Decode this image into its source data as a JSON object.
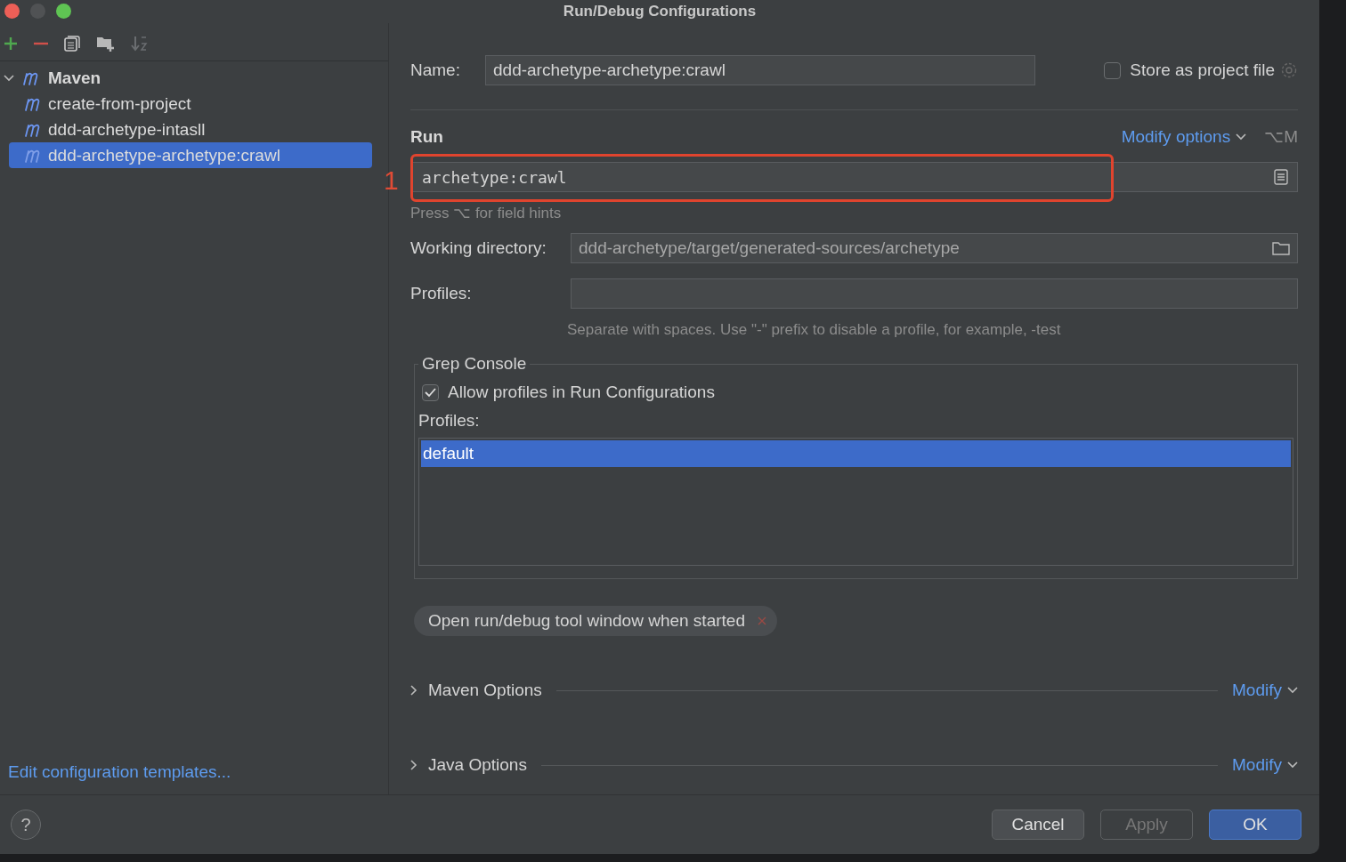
{
  "window": {
    "title": "Run/Debug Configurations"
  },
  "tree": {
    "label": "Maven",
    "expanded": true,
    "children": [
      {
        "label": "create-from-project",
        "selected": false
      },
      {
        "label": "ddd-archetype-intasll",
        "selected": false
      },
      {
        "label": "ddd-archetype-archetype:crawl",
        "selected": true
      }
    ]
  },
  "edit_templates_link": "Edit configuration templates...",
  "help": "?",
  "name_field": {
    "label": "Name:",
    "value": "ddd-archetype-archetype:crawl"
  },
  "store_as_project_file": {
    "label": "Store as project file",
    "checked": false
  },
  "run_section": {
    "title": "Run",
    "modify_options": "Modify options",
    "shortcut": "⌥M",
    "command": "archetype:crawl",
    "hint": "Press ⌥ for field hints",
    "annotation": "1"
  },
  "working_directory": {
    "label": "Working directory:",
    "value": "ddd-archetype/target/generated-sources/archetype"
  },
  "profiles": {
    "label": "Profiles:",
    "hint": "Separate with spaces. Use \"-\" prefix to disable a profile, for example, -test"
  },
  "grep_console": {
    "title": "Grep Console",
    "allow_profiles": {
      "label": "Allow profiles in Run Configurations",
      "checked": true
    },
    "profiles_label": "Profiles:",
    "profiles": [
      {
        "name": "default",
        "selected": true
      }
    ]
  },
  "option_tags": [
    {
      "label": "Open run/debug tool window when started"
    }
  ],
  "sections": [
    {
      "title": "Maven Options",
      "expanded": false,
      "action": "Modify"
    },
    {
      "title": "Java Options",
      "expanded": false,
      "action": "Modify"
    }
  ],
  "buttons": [
    {
      "label": "Cancel",
      "kind": "normal"
    },
    {
      "label": "Apply",
      "kind": "disabled"
    },
    {
      "label": "OK",
      "kind": "default"
    }
  ]
}
